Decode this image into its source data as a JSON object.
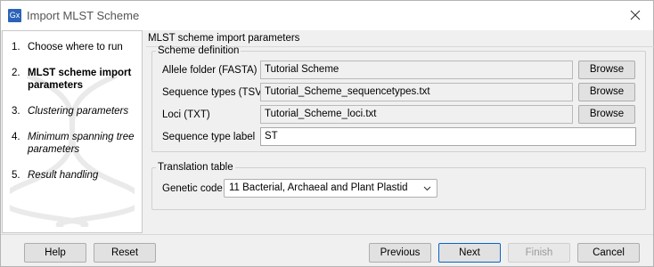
{
  "window": {
    "title": "Import MLST Scheme",
    "app_icon_text": "Gx"
  },
  "steps": [
    {
      "num": "1.",
      "label": "Choose where to run",
      "state": "done"
    },
    {
      "num": "2.",
      "label": "MLST scheme import parameters",
      "state": "current"
    },
    {
      "num": "3.",
      "label": "Clustering parameters",
      "state": "future"
    },
    {
      "num": "4.",
      "label": "Minimum spanning tree parameters",
      "state": "future"
    },
    {
      "num": "5.",
      "label": "Result handling",
      "state": "future"
    }
  ],
  "main": {
    "title": "MLST scheme import parameters",
    "scheme_definition": {
      "legend": "Scheme definition",
      "allele_folder": {
        "label": "Allele folder (FASTA)",
        "value": "Tutorial Scheme",
        "button": "Browse"
      },
      "sequence_types": {
        "label": "Sequence types (TSV)",
        "value": "Tutorial_Scheme_sequencetypes.txt",
        "button": "Browse"
      },
      "loci": {
        "label": "Loci (TXT)",
        "value": "Tutorial_Scheme_loci.txt",
        "button": "Browse"
      },
      "sequence_type_label": {
        "label": "Sequence type label",
        "value": "ST"
      }
    },
    "translation_table": {
      "legend": "Translation table",
      "genetic_code": {
        "label": "Genetic code",
        "value": "11 Bacterial, Archaeal and Plant Plastid"
      }
    }
  },
  "footer": {
    "help": "Help",
    "reset": "Reset",
    "previous": "Previous",
    "next": "Next",
    "finish": "Finish",
    "cancel": "Cancel"
  },
  "colors": {
    "accent": "#0a64c8",
    "app_icon": "#2a63b8"
  }
}
